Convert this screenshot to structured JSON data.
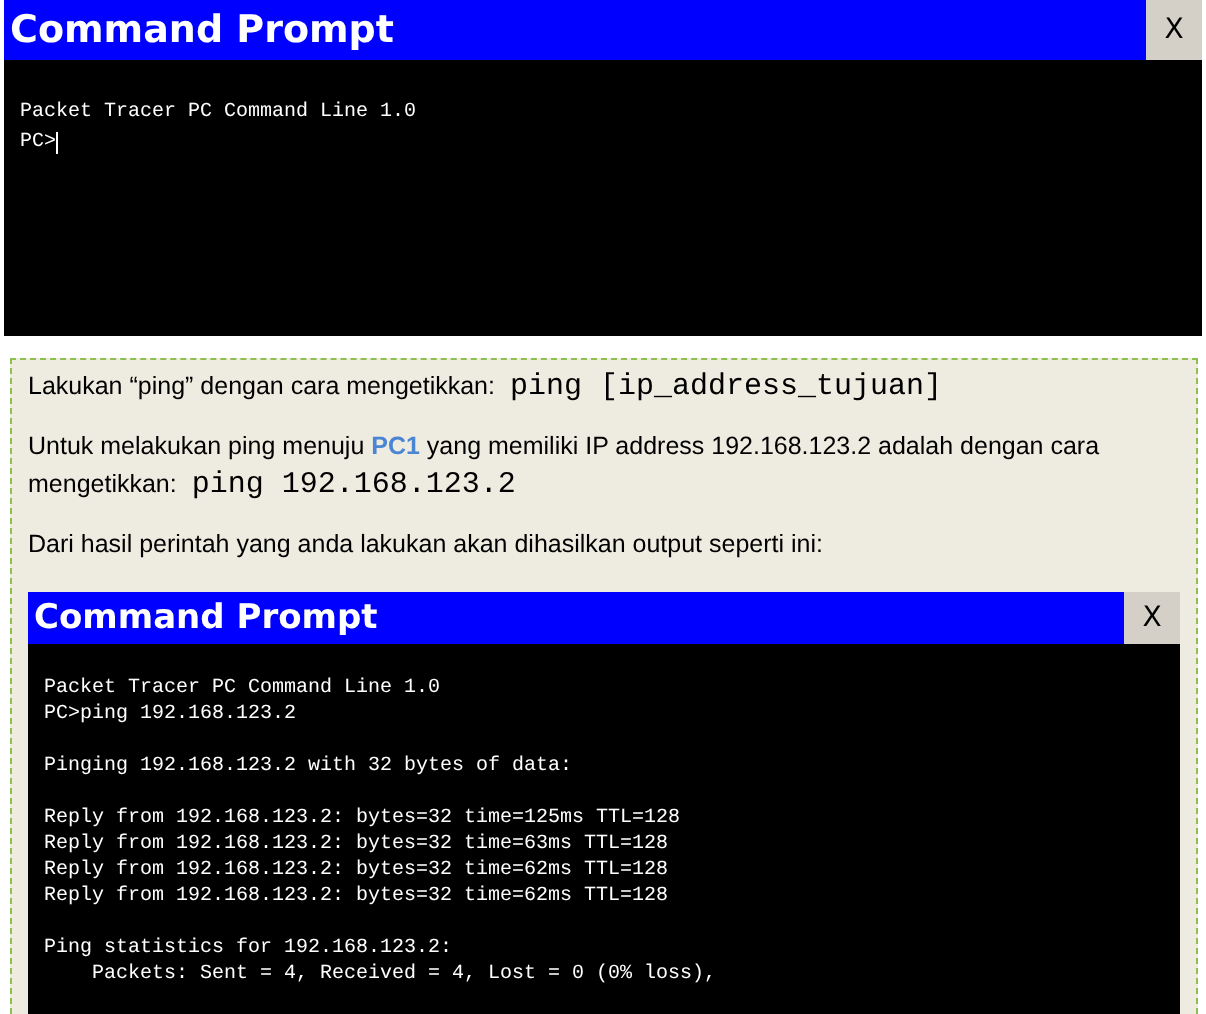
{
  "windows": [
    {
      "title": "Command Prompt",
      "close": "X",
      "blocks": [
        [
          "Packet Tracer PC Command Line 1.0",
          "PC>"
        ]
      ],
      "cursor": true
    },
    {
      "title": "Command Prompt",
      "close": "X",
      "blocks": [
        [
          "Packet Tracer PC Command Line 1.0",
          "PC>ping 192.168.123.2"
        ],
        [
          "Pinging 192.168.123.2 with 32 bytes of data:"
        ],
        [
          "Reply from 192.168.123.2: bytes=32 time=125ms TTL=128",
          "Reply from 192.168.123.2: bytes=32 time=63ms TTL=128",
          "Reply from 192.168.123.2: bytes=32 time=62ms TTL=128",
          "Reply from 192.168.123.2: bytes=32 time=62ms TTL=128"
        ],
        [
          "Ping statistics for 192.168.123.2:",
          "    Packets: Sent = 4, Received = 4, Lost = 0 (0% loss),"
        ]
      ],
      "cursor": false
    }
  ],
  "instructions": [
    {
      "parts": [
        {
          "kind": "text",
          "text": "Lakukan “ping” dengan cara mengetikkan: "
        },
        {
          "kind": "code",
          "text": "ping [ip_address_tujuan]"
        }
      ]
    },
    {
      "parts": [
        {
          "kind": "text",
          "text": "Untuk melakukan ping menuju "
        },
        {
          "kind": "highlight",
          "text": "PC1"
        },
        {
          "kind": "text",
          "text": " yang memiliki IP address 192.168.123.2 adalah dengan cara mengetikkan: "
        },
        {
          "kind": "code",
          "text": "ping 192.168.123.2"
        }
      ]
    },
    {
      "parts": [
        {
          "kind": "text",
          "text": "Dari hasil perintah yang anda lakukan akan dihasilkan output seperti ini:"
        }
      ]
    }
  ]
}
